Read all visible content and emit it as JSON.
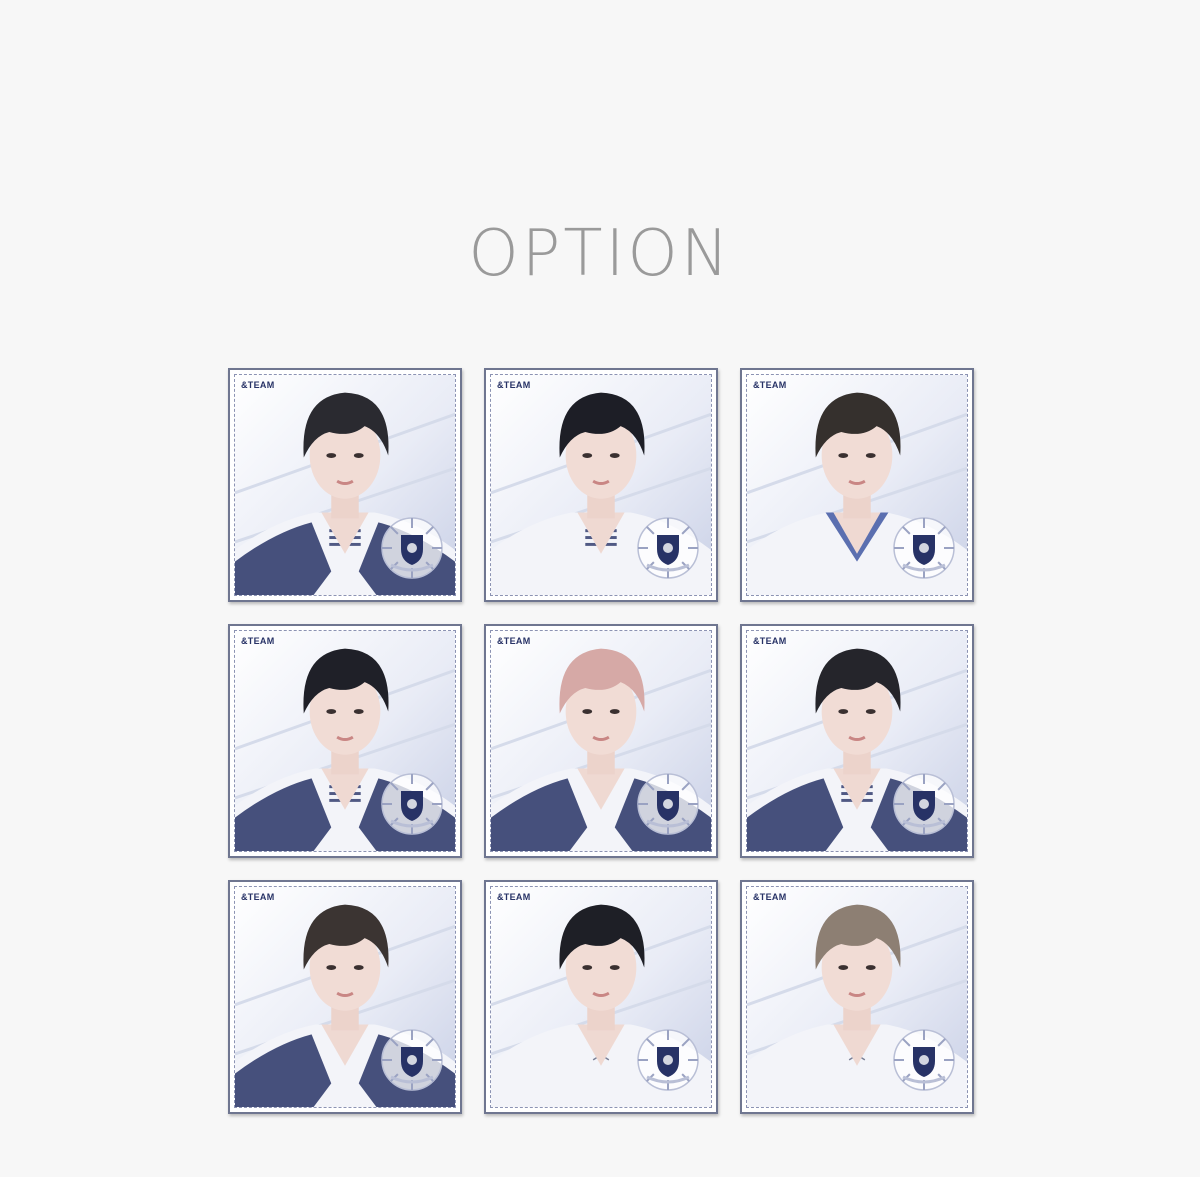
{
  "page": {
    "title": "OPTION"
  },
  "colors": {
    "background": "#f7f7f7",
    "title": "#9a9a9a",
    "card_border": "#6f7690",
    "accent_navy": "#273266"
  },
  "cards": [
    {
      "brand": "&TEAM",
      "hair": "#2a2a30",
      "collar": "navy-stripe"
    },
    {
      "brand": "&TEAM",
      "hair": "#1d1e26",
      "collar": "stripe"
    },
    {
      "brand": "&TEAM",
      "hair": "#35302d",
      "collar": "scarf"
    },
    {
      "brand": "&TEAM",
      "hair": "#1f2028",
      "collar": "navy-stripe"
    },
    {
      "brand": "&TEAM",
      "hair": "#d6a9a6",
      "collar": "navy"
    },
    {
      "brand": "&TEAM",
      "hair": "#25252b",
      "collar": "navy-stripe"
    },
    {
      "brand": "&TEAM",
      "hair": "#3b3432",
      "collar": "navy"
    },
    {
      "brand": "&TEAM",
      "hair": "#1e1f26",
      "collar": "laced"
    },
    {
      "brand": "&TEAM",
      "hair": "#8d7f73",
      "collar": "laced"
    }
  ]
}
